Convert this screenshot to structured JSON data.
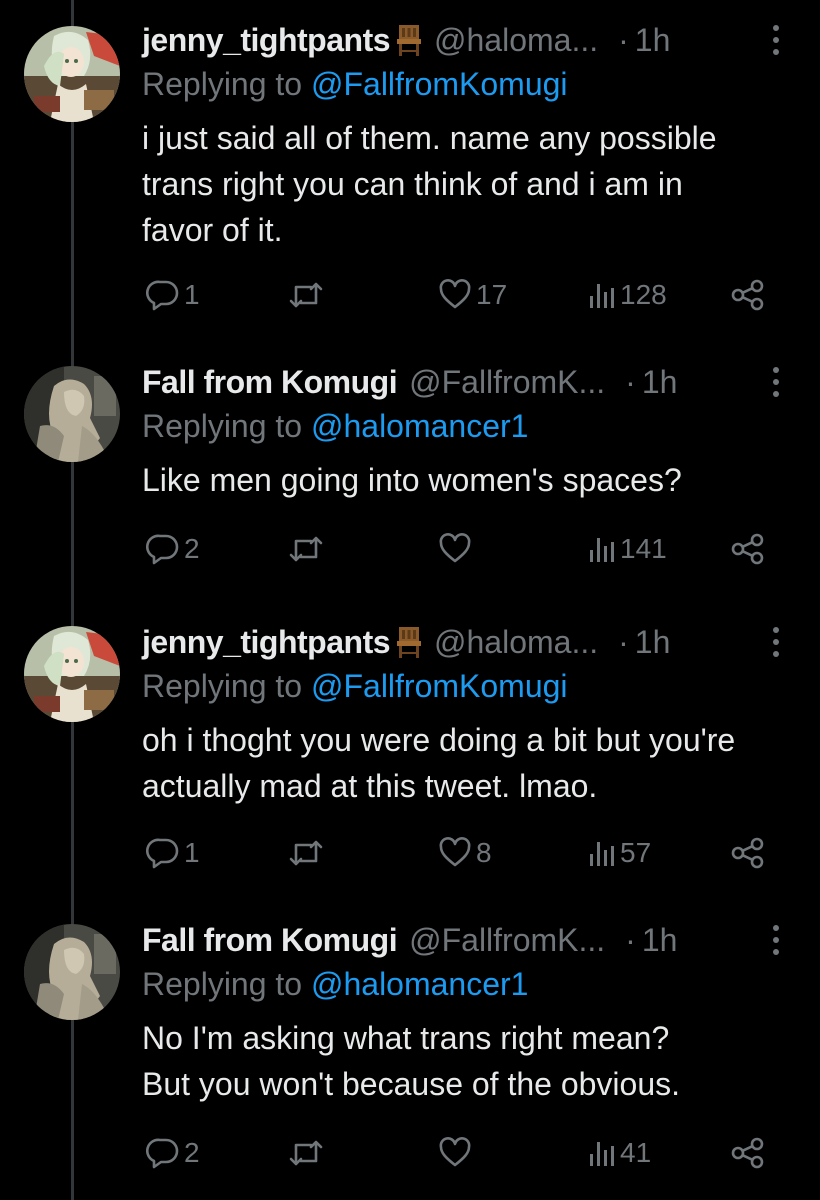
{
  "tweets": [
    {
      "author": "jenny_tightpants",
      "handle": "@haloma...",
      "dot": "·",
      "time": "1h",
      "reply_prefix": "Replying to ",
      "reply_to": "@FallfromKomugi",
      "text_lines": [
        "i just said all of them. name any possible",
        "trans right you can think of and i am in",
        "favor of it."
      ],
      "replies": "1",
      "reposts": "",
      "likes": "17",
      "views": "128",
      "avatar": "anime-character-avatar"
    },
    {
      "author": "Fall from Komugi",
      "handle": "@FallfromK...",
      "dot": "·",
      "time": "1h",
      "reply_prefix": "Replying to ",
      "reply_to": "@halomancer1",
      "text_lines": [
        "Like men going into women's spaces?"
      ],
      "replies": "2",
      "reposts": "",
      "likes": "",
      "views": "141",
      "avatar": "statue-avatar"
    },
    {
      "author": "jenny_tightpants",
      "handle": "@haloma...",
      "dot": "·",
      "time": "1h",
      "reply_prefix": "Replying to ",
      "reply_to": "@FallfromKomugi",
      "text_lines": [
        "oh i thoght you were doing a bit but you're",
        "actually mad at this tweet. lmao."
      ],
      "replies": "1",
      "reposts": "",
      "likes": "8",
      "views": "57",
      "avatar": "anime-character-avatar"
    },
    {
      "author": "Fall from Komugi",
      "handle": "@FallfromK...",
      "dot": "·",
      "time": "1h",
      "reply_prefix": "Replying to ",
      "reply_to": "@halomancer1",
      "text_lines": [
        "No I'm asking what trans right mean?",
        "But you won't because of the obvious."
      ],
      "replies": "2",
      "reposts": "",
      "likes": "",
      "views": "41",
      "avatar": "statue-avatar"
    }
  ],
  "icons": {
    "reply": "reply-icon",
    "repost": "repost-icon",
    "like": "heart-icon",
    "views": "views-icon",
    "share": "share-icon",
    "more": "more-icon",
    "chair": "chair-icon"
  },
  "colors": {
    "background": "#000000",
    "text": "#e7e9ea",
    "muted": "#71767b",
    "mention": "#1d9bf0",
    "thread_line": "#333639"
  }
}
